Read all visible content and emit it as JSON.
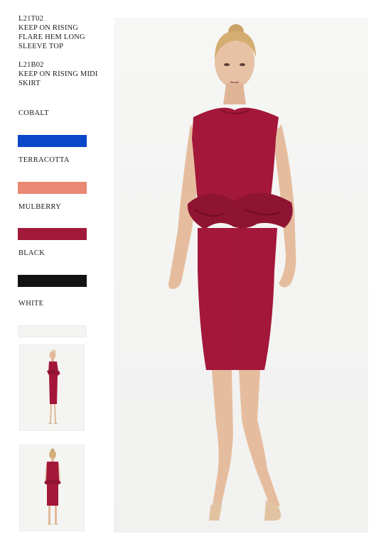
{
  "products": [
    {
      "code": "L21T02",
      "name_lines": [
        "KEEP ON RISING",
        "FLARE HEM LONG",
        "SLEEVE TOP"
      ]
    },
    {
      "code": "L21B02",
      "name_lines": [
        "KEEP ON RISING MIDI",
        "SKIRT"
      ]
    }
  ],
  "colours": [
    {
      "name": "COBALT",
      "hex": "#0a47c9"
    },
    {
      "name": "TERRACOTTA",
      "hex": "#ea8873"
    },
    {
      "name": "MULBERRY",
      "hex": "#a11a3a"
    },
    {
      "name": "BLACK",
      "hex": "#131313"
    },
    {
      "name": "WHITE",
      "hex": "#f3f3f1"
    }
  ],
  "garment_colour": "#a3173a",
  "thumbnails": [
    {
      "name": "side-view-thumbnail"
    },
    {
      "name": "back-view-thumbnail"
    }
  ]
}
